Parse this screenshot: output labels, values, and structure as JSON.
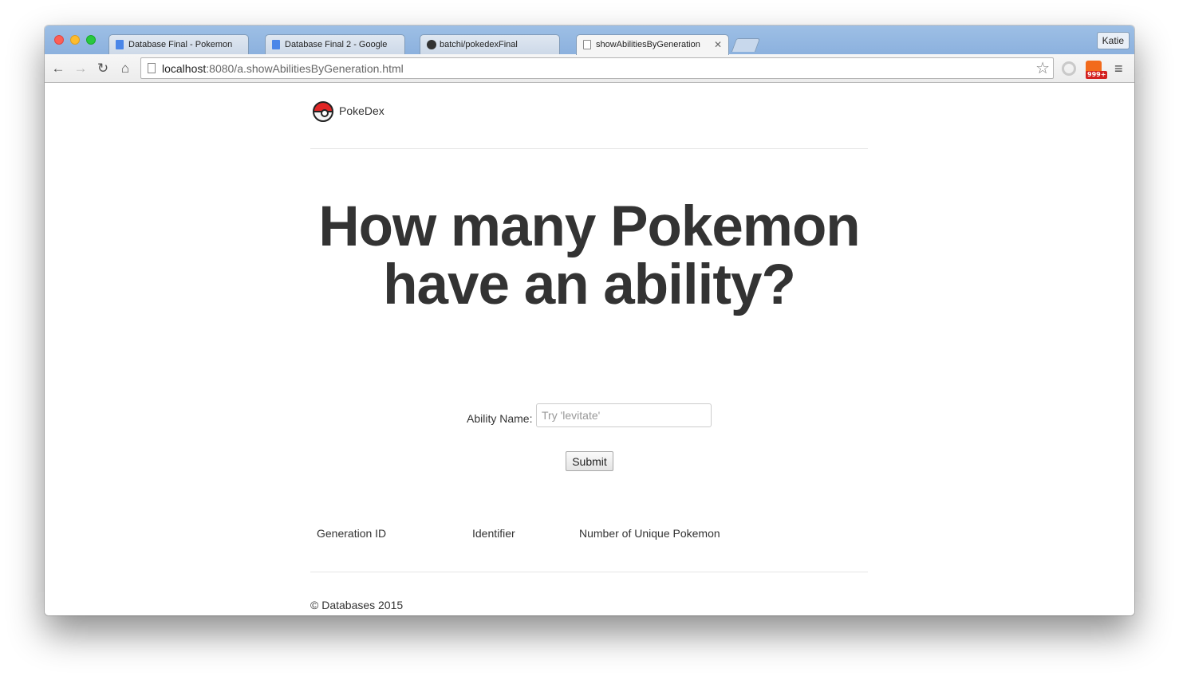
{
  "browser": {
    "tabs": [
      {
        "label": "Database Final - Pokemon",
        "icon": "google-docs-icon"
      },
      {
        "label": "Database Final 2 - Google",
        "icon": "google-docs-icon"
      },
      {
        "label": "batchi/pokedexFinal",
        "icon": "github-icon"
      },
      {
        "label": "showAbilitiesByGeneration",
        "icon": "page-icon",
        "active": true
      }
    ],
    "user": "Katie",
    "url_host": "localhost",
    "url_rest": ":8080/a.showAbilitiesByGeneration.html",
    "rss_badge": "999+"
  },
  "page": {
    "brand": "PokeDex",
    "headline": "How many Pokemon have an ability?",
    "form": {
      "label": "Ability Name:",
      "placeholder": "Try 'levitate'",
      "submit": "Submit"
    },
    "table": {
      "headers": [
        "Generation ID",
        "Identifier",
        "Number of Unique Pokemon"
      ]
    },
    "footer": "© Databases 2015"
  }
}
